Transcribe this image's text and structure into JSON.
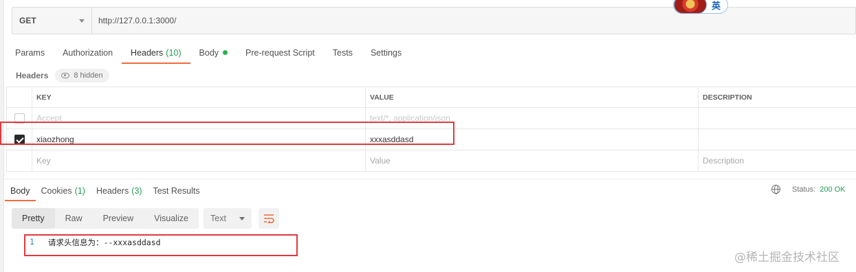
{
  "request": {
    "method": "GET",
    "url": "http://127.0.0.1:3000/"
  },
  "ime_label": "英",
  "request_tabs": [
    {
      "label": "Params"
    },
    {
      "label": "Authorization"
    },
    {
      "label": "Headers",
      "count": "(10)"
    },
    {
      "label": "Body"
    },
    {
      "label": "Pre-request Script"
    },
    {
      "label": "Tests"
    },
    {
      "label": "Settings"
    }
  ],
  "headers_section": {
    "title": "Headers",
    "hidden_label": "8 hidden"
  },
  "headers_table": {
    "columns": [
      "KEY",
      "VALUE",
      "DESCRIPTION"
    ],
    "rows": [
      {
        "key": "Accept",
        "value": "text/*, application/json",
        "description": ""
      },
      {
        "key": "xiaozhong",
        "value": "xxxasddasd",
        "description": ""
      }
    ],
    "placeholders": {
      "key": "Key",
      "value": "Value",
      "description": "Description"
    }
  },
  "response_tabs": [
    {
      "label": "Body"
    },
    {
      "label": "Cookies",
      "count": "(1)"
    },
    {
      "label": "Headers",
      "count": "(3)"
    },
    {
      "label": "Test Results"
    }
  ],
  "status": {
    "label": "Status:",
    "value": "200 OK"
  },
  "view_modes": [
    "Pretty",
    "Raw",
    "Preview",
    "Visualize"
  ],
  "format": "Text",
  "response_body": {
    "line_number": "1",
    "text": "请求头信息为：--xxxasddasd"
  },
  "watermark": "@稀土掘金技术社区",
  "colors": {
    "accent": "#f26b3a",
    "success": "#1f9d55",
    "highlight_box": "#e0383e"
  }
}
